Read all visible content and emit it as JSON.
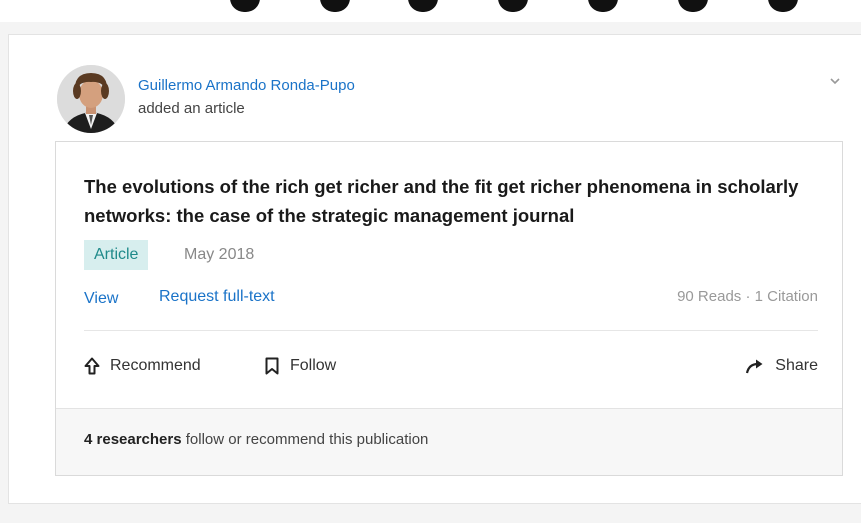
{
  "post": {
    "author": {
      "name": "Guillermo Armando Ronda-Pupo",
      "action": "added an article"
    },
    "article": {
      "title": "The evolutions of the rich get richer and the fit get richer phenomena in scholarly networks: the case of the strategic management journal",
      "type": "Article",
      "date": "May 2018",
      "links": {
        "view": "View",
        "request": "Request full-text"
      },
      "stats": "90 Reads · 1 Citation"
    },
    "actions": {
      "recommend": "Recommend",
      "follow": "Follow",
      "share": "Share"
    },
    "footer": {
      "count": "4 researchers",
      "text": " follow or recommend this publication"
    }
  },
  "icons": {
    "menu": "chevron-down-icon",
    "recommend": "arrow-up-icon",
    "follow": "bookmark-icon",
    "share": "share-arrow-icon"
  },
  "colors": {
    "link": "#1a73c8",
    "badge_bg": "#d7eeee",
    "badge_text": "#1f8a8a"
  }
}
